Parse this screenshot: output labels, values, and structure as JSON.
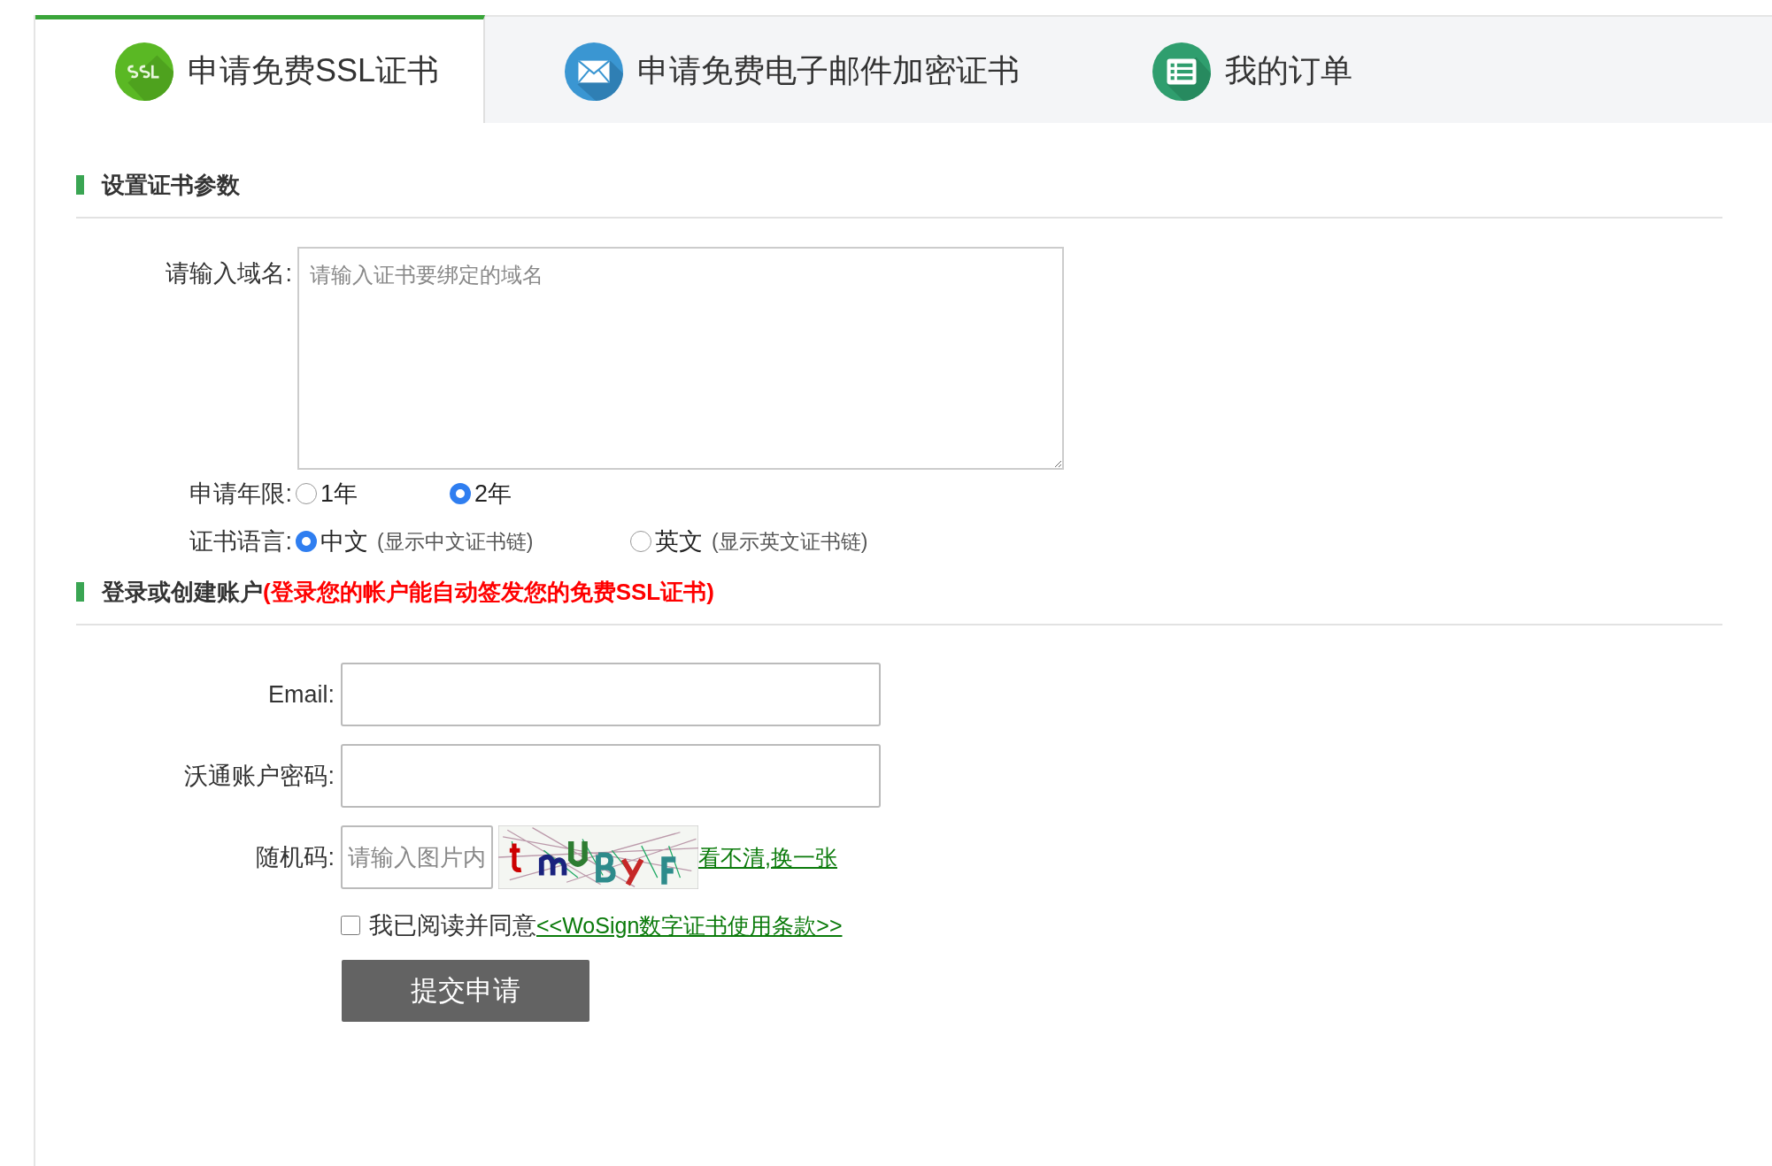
{
  "tabs": [
    {
      "label": "申请免费SSL证书",
      "kind": "ssl",
      "selected": true
    },
    {
      "label": "申请免费电子邮件加密证书",
      "kind": "mail",
      "selected": false
    },
    {
      "label": "我的订单",
      "kind": "list",
      "selected": false
    }
  ],
  "cert_section": {
    "title": "设置证书参数",
    "domain": {
      "label": "请输入域名:",
      "placeholder": "请输入证书要绑定的域名"
    },
    "period": {
      "label": "申请年限:",
      "options": [
        {
          "label": "1年",
          "selected": false
        },
        {
          "label": "2年",
          "selected": true
        }
      ]
    },
    "language": {
      "label": "证书语言:",
      "options": [
        {
          "label": "中文",
          "note": "(显示中文证书链)",
          "selected": true
        },
        {
          "label": "英文",
          "note": "(显示英文证书链)",
          "selected": false
        }
      ]
    }
  },
  "account_section": {
    "title": "登录或创建账户",
    "highlight": "(登录您的帐户能自动签发您的免费SSL证书)",
    "email": {
      "label": "Email:"
    },
    "password": {
      "label": "沃通账户密码:"
    },
    "captcha": {
      "label": "随机码:",
      "placeholder": "请输入图片内",
      "refresh_link": "看不清,换一张"
    },
    "agree": {
      "text": "我已阅读并同意",
      "link": "<<WoSign数字证书使用条款>>",
      "checked": false
    },
    "submit": "提交申请"
  }
}
